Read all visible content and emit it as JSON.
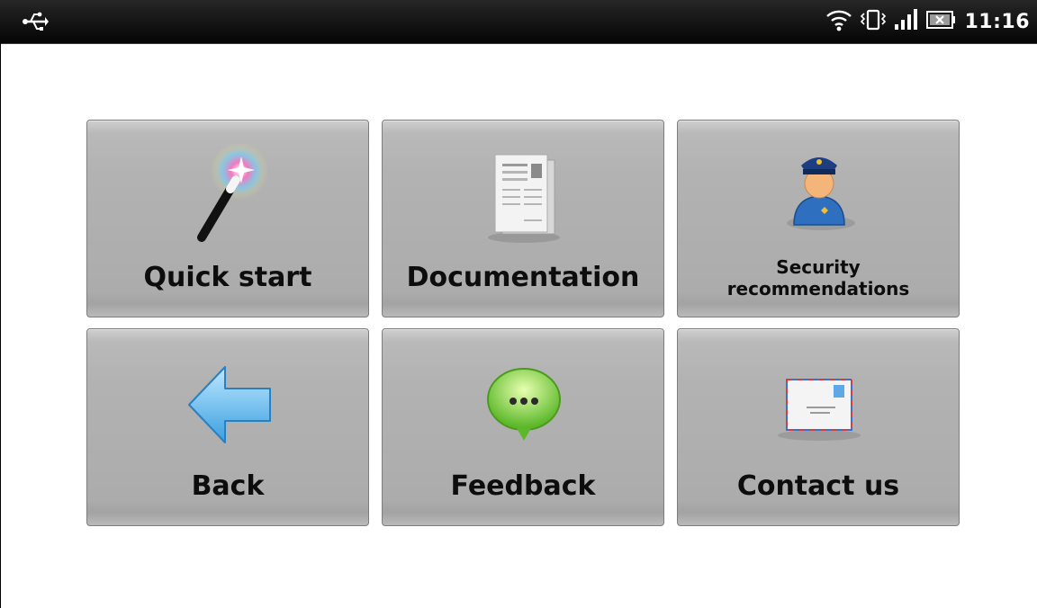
{
  "status_bar": {
    "time": "11:16",
    "left_icon": "usb-icon",
    "right_icons": [
      "wifi-icon",
      "vibrate-icon",
      "signal-icon",
      "battery-icon"
    ]
  },
  "tiles": [
    {
      "label": "Quick start",
      "icon": "magic-wand-icon"
    },
    {
      "label": "Documentation",
      "icon": "document-icon"
    },
    {
      "label": "Security recommendations",
      "icon": "security-officer-icon"
    },
    {
      "label": "Back",
      "icon": "back-arrow-icon"
    },
    {
      "label": "Feedback",
      "icon": "speech-bubble-icon"
    },
    {
      "label": "Contact us",
      "icon": "envelope-icon"
    }
  ],
  "colors": {
    "tile_bg": "#b2b2b2",
    "status_bar_bg": "#111111",
    "page_bg": "#ffffff"
  }
}
